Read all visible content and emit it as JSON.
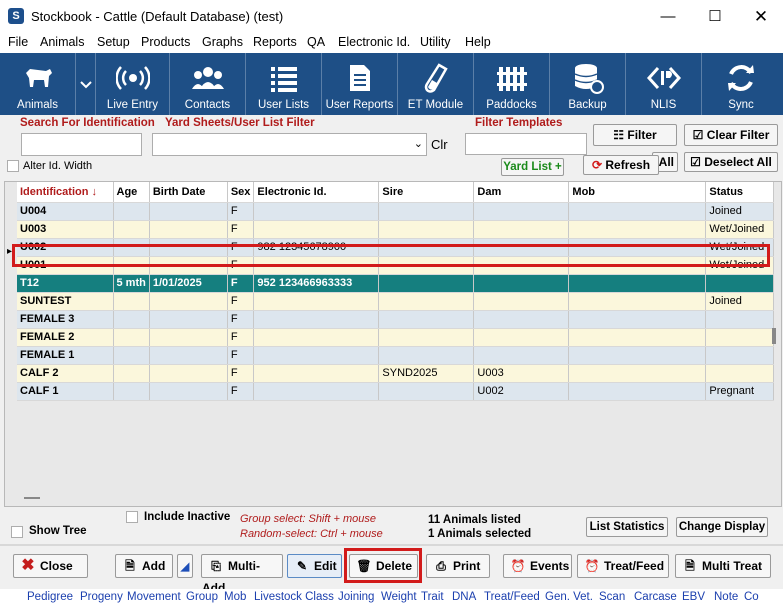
{
  "window": {
    "title": "Stockbook - Cattle (Default Database) (test)",
    "app_icon": "S"
  },
  "menu": [
    "File",
    "Animals",
    "Setup",
    "Products",
    "Graphs",
    "Reports",
    "QA",
    "Electronic Id.",
    "Utility",
    "Help"
  ],
  "toolbar": [
    {
      "label": "Animals",
      "icon": "cow-icon"
    },
    {
      "label": "Live Entry",
      "icon": "rfid-signal-icon"
    },
    {
      "label": "Contacts",
      "icon": "people-icon"
    },
    {
      "label": "User Lists",
      "icon": "list-icon"
    },
    {
      "label": "User Reports",
      "icon": "report-icon"
    },
    {
      "label": "ET Module",
      "icon": "test-tube-icon"
    },
    {
      "label": "Paddocks",
      "icon": "fence-icon"
    },
    {
      "label": "Backup",
      "icon": "database-icon"
    },
    {
      "label": "NLIS",
      "icon": "nlis-icon"
    },
    {
      "label": "Sync",
      "icon": "sync-icon"
    }
  ],
  "filters": {
    "search_label": "Search For Identification",
    "yard_label": "Yard Sheets/User List Filter",
    "template_label": "Filter Templates",
    "clr_label": "Clr",
    "alter_id_label": "Alter Id. Width",
    "yard_list_label": "Yard List +",
    "filter_btn": "Filter",
    "clear_filter_btn": "Clear Filter",
    "refresh_btn": "Refresh",
    "all_btn": "All",
    "deselect_all_btn": "Deselect All"
  },
  "grid": {
    "columns": [
      "Identification",
      "Age",
      "Birth Date",
      "Sex",
      "Electronic Id.",
      "Sire",
      "Dam",
      "Mob",
      "Status"
    ],
    "rows": [
      {
        "id": "U004",
        "age": "",
        "birth": "",
        "sex": "F",
        "eid": "",
        "sire": "",
        "dam": "",
        "mob": "",
        "status": "Joined"
      },
      {
        "id": "U003",
        "age": "",
        "birth": "",
        "sex": "F",
        "eid": "",
        "sire": "",
        "dam": "",
        "mob": "",
        "status": "Wet/Joined"
      },
      {
        "id": "U002",
        "age": "",
        "birth": "",
        "sex": "F",
        "eid": "982 12345678900",
        "sire": "",
        "dam": "",
        "mob": "",
        "status": "Wet/Joined"
      },
      {
        "id": "U001",
        "age": "",
        "birth": "",
        "sex": "F",
        "eid": "",
        "sire": "",
        "dam": "",
        "mob": "",
        "status": "Wet/Joined"
      },
      {
        "id": "T12",
        "age": "5 mth",
        "birth": "1/01/2025",
        "sex": "F",
        "eid": "952 123466963333",
        "sire": "",
        "dam": "",
        "mob": "",
        "status": ""
      },
      {
        "id": "SUNTEST",
        "age": "",
        "birth": "",
        "sex": "F",
        "eid": "",
        "sire": "",
        "dam": "",
        "mob": "",
        "status": "Joined"
      },
      {
        "id": "FEMALE 3",
        "age": "",
        "birth": "",
        "sex": "F",
        "eid": "",
        "sire": "",
        "dam": "",
        "mob": "",
        "status": ""
      },
      {
        "id": "FEMALE 2",
        "age": "",
        "birth": "",
        "sex": "F",
        "eid": "",
        "sire": "",
        "dam": "",
        "mob": "",
        "status": ""
      },
      {
        "id": "FEMALE 1",
        "age": "",
        "birth": "",
        "sex": "F",
        "eid": "",
        "sire": "",
        "dam": "",
        "mob": "",
        "status": ""
      },
      {
        "id": "CALF 2",
        "age": "",
        "birth": "",
        "sex": "F",
        "eid": "",
        "sire": "SYND2025",
        "dam": "U003",
        "mob": "",
        "status": ""
      },
      {
        "id": "CALF 1",
        "age": "",
        "birth": "",
        "sex": "F",
        "eid": "",
        "sire": "",
        "dam": "U002",
        "mob": "",
        "status": "Pregnant"
      }
    ],
    "selected_index": 4
  },
  "status": {
    "show_tree": "Show Tree",
    "include_inactive": "Include Inactive",
    "group_hint": "Group select: Shift + mouse",
    "random_hint": "Random-select: Ctrl + mouse",
    "listed": "11 Animals listed",
    "selected": "1 Animals selected",
    "list_stats_btn": "List Statistics",
    "change_display_btn": "Change Display"
  },
  "actions": [
    {
      "label": "Close",
      "icon": "close-x-icon"
    },
    {
      "label": "Add",
      "icon": "add-document-icon"
    },
    {
      "label": "",
      "icon": "sort-triangle-icon"
    },
    {
      "label": "Multi-Add",
      "icon": "multi-add-icon"
    },
    {
      "label": "Edit",
      "icon": "edit-icon"
    },
    {
      "label": "Delete",
      "icon": "trash-icon"
    },
    {
      "label": "Print",
      "icon": "printer-icon"
    },
    {
      "label": "Events",
      "icon": "alarm-clock-icon"
    },
    {
      "label": "Treat/Feed",
      "icon": "alarm-clock-icon"
    },
    {
      "label": "Multi Treat",
      "icon": "multi-document-icon"
    }
  ],
  "nav_tabs": [
    "Pedigree",
    "Progeny",
    "Movement",
    "Group",
    "Mob",
    "Livestock Class",
    "Joining",
    "Weight",
    "Trait",
    "DNA",
    "Treat/Feed",
    "Gen. Vet.",
    "Scan",
    "Carcase",
    "EBV",
    "Note",
    "Co"
  ],
  "colors": {
    "toolbar_bg": "#1e4f86",
    "selected_row": "#157f7f",
    "highlight_red": "#d21b1b",
    "label_red": "#b01c1c"
  }
}
